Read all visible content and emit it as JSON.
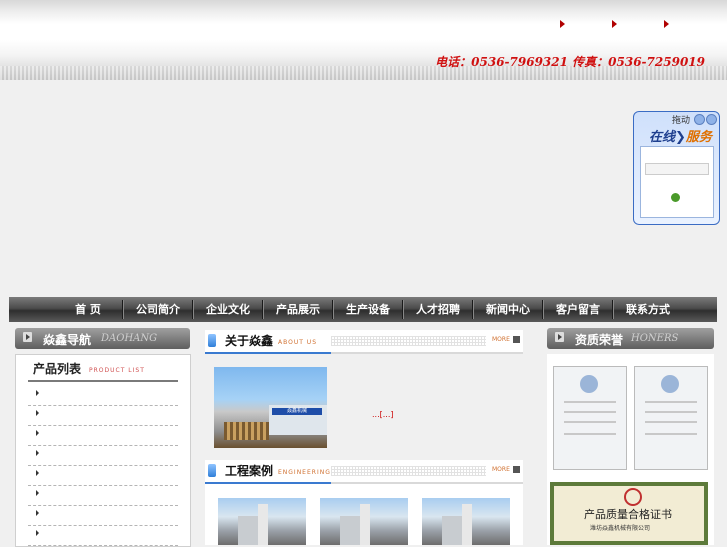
{
  "header": {
    "contact": "电话：0536-7969321  传真：0536-7259019"
  },
  "service": {
    "drag_label": "拖动",
    "title_online": "在线",
    "title_service": "服务"
  },
  "nav": {
    "items": [
      "首 页",
      "公司简介",
      "企业文化",
      "产品展示",
      "生产设备",
      "人才招聘",
      "新闻中心",
      "客户留言",
      "联系方式"
    ]
  },
  "left": {
    "header_cn": "焱鑫导航",
    "header_en": "DAOHANG",
    "list_title": "产品列表",
    "list_title_en": "PRODUCT LIST"
  },
  "about": {
    "title": "关于焱鑫",
    "title_en": "ABOUT US",
    "more": "MORE",
    "image_sign": "焱鑫机械",
    "text": "...[...]"
  },
  "cases": {
    "title": "工程案例",
    "title_en": "ENGINEERING",
    "more": "MORE"
  },
  "right": {
    "header_cn": "资质荣誉",
    "header_en": "HONERS",
    "quality_title": "产品质量合格证书",
    "quality_sub": "潍坊焱鑫机械有限公司"
  },
  "colors": {
    "contact_red": "#d01010",
    "nav_dark": "#3a3a3a",
    "accent_blue": "#3a7ad0"
  }
}
